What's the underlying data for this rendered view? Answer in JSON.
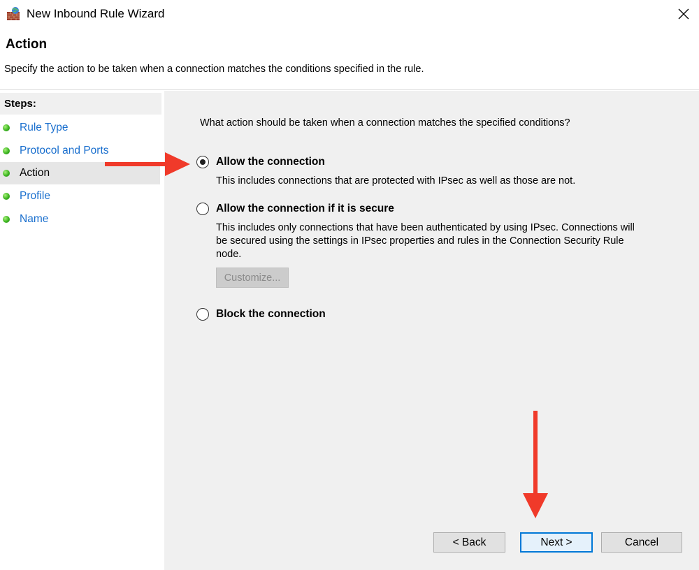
{
  "window": {
    "title": "New Inbound Rule Wizard"
  },
  "header": {
    "title": "Action",
    "subtitle": "Specify the action to be taken when a connection matches the conditions specified in the rule."
  },
  "sidebar": {
    "heading": "Steps:",
    "items": [
      {
        "label": "Rule Type",
        "active": false
      },
      {
        "label": "Protocol and Ports",
        "active": false
      },
      {
        "label": "Action",
        "active": true
      },
      {
        "label": "Profile",
        "active": false
      },
      {
        "label": "Name",
        "active": false
      }
    ]
  },
  "main": {
    "question": "What action should be taken when a connection matches the specified conditions?",
    "options": [
      {
        "label": "Allow the connection",
        "description": "This includes connections that are protected with IPsec as well as those are not.",
        "checked": true
      },
      {
        "label": "Allow the connection if it is secure",
        "description": "This includes only connections that have been authenticated by using IPsec.  Connections will be secured using the settings in IPsec properties and rules in the Connection Security Rule node.",
        "checked": false
      },
      {
        "label": "Block the connection",
        "description": "",
        "checked": false
      }
    ],
    "customize_label": "Customize..."
  },
  "footer": {
    "back_label": "< Back",
    "next_label": "Next >",
    "cancel_label": "Cancel"
  },
  "colors": {
    "annotation_arrow": "#f03a2a",
    "link_blue": "#1a6fce",
    "default_button_border": "#0078d7"
  }
}
